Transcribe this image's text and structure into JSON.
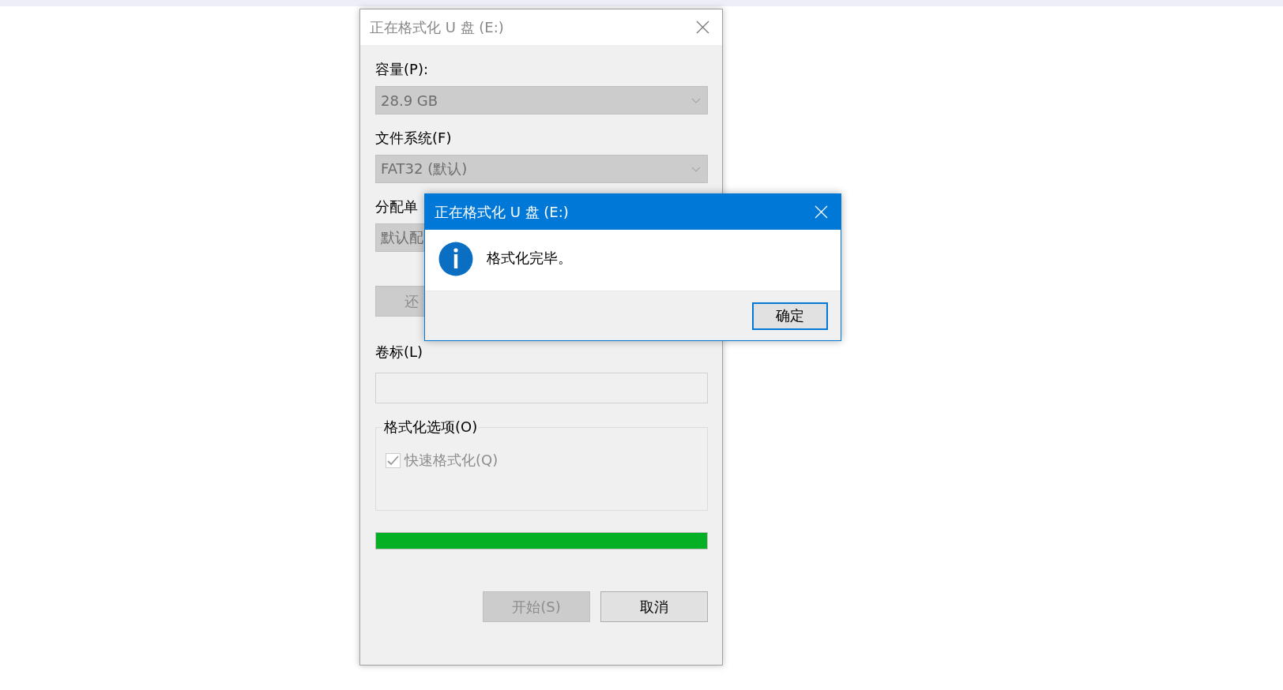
{
  "format_window": {
    "title": "正在格式化 U 盘 (E:)",
    "fields": [
      {
        "kind": "dropdown",
        "label": "容量(P):",
        "value": "28.9 GB",
        "disabled": true
      },
      {
        "kind": "dropdown",
        "label": "文件系统(F)",
        "value": "FAT32 (默认)",
        "disabled": true
      },
      {
        "kind": "covered_dropdown",
        "label": "分配单",
        "value": "默认配",
        "disabled": true
      },
      {
        "kind": "button",
        "label": "还",
        "disabled": true
      },
      {
        "kind": "textbox",
        "label": "卷标(L)",
        "disabled": true
      }
    ],
    "options_group": {
      "title": "格式化选项(O)",
      "checkbox": {
        "label": "快速格式化(Q)",
        "checked": true,
        "disabled": true
      }
    },
    "progress": {
      "level": 1
    },
    "buttons": [
      {
        "label": "开始(S)",
        "disabled": true
      },
      {
        "label": "取消",
        "disabled": false
      }
    ]
  },
  "message_box": {
    "title": "正在格式化 U 盘 (E:)",
    "message": "格式化完毕。",
    "buttons": [
      {
        "label": "确定",
        "focused": true
      }
    ]
  }
}
